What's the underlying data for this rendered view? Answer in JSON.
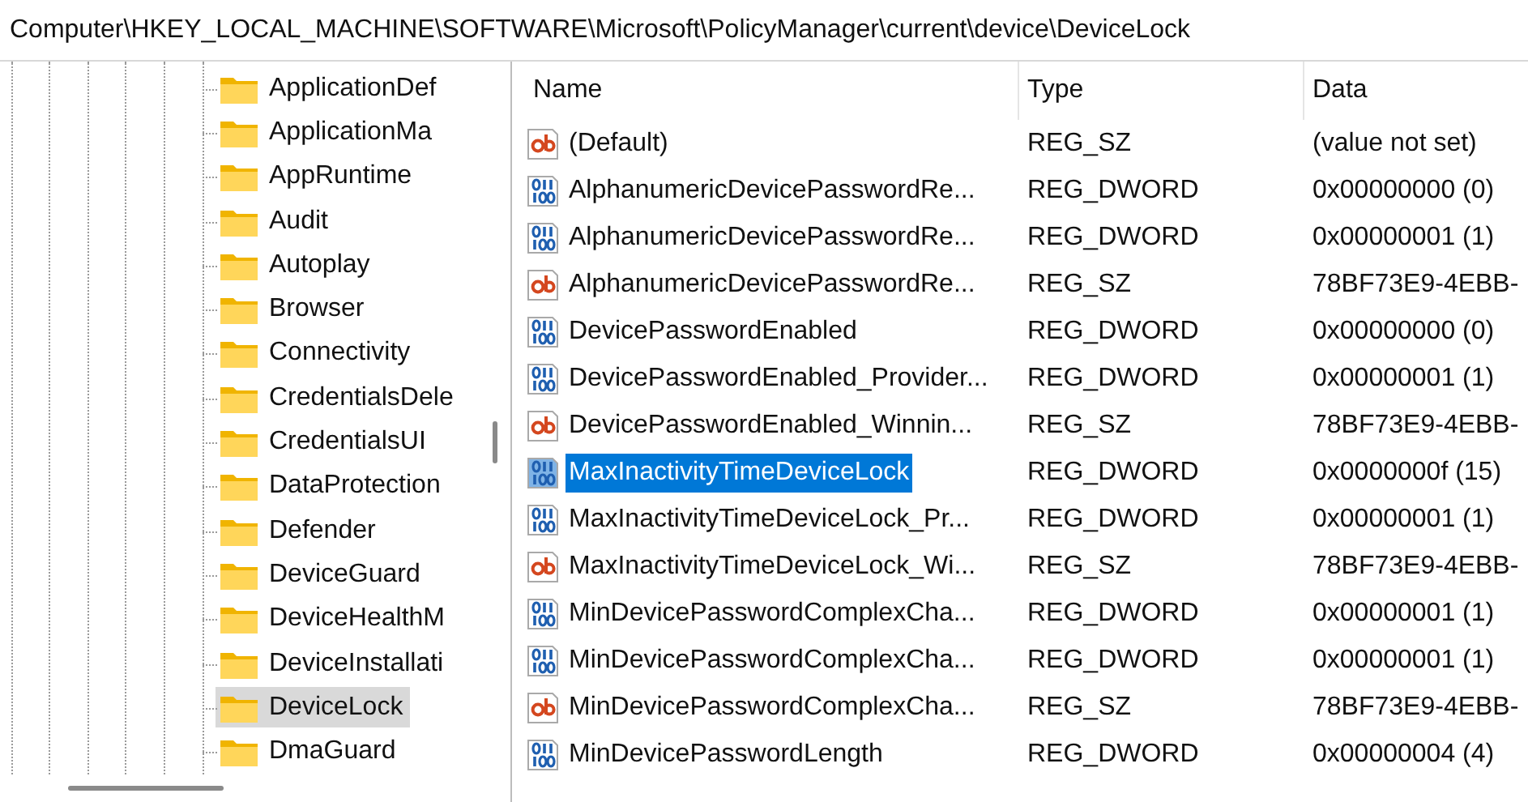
{
  "address_bar": {
    "path": "Computer\\HKEY_LOCAL_MACHINE\\SOFTWARE\\Microsoft\\PolicyManager\\current\\device\\DeviceLock"
  },
  "tree": {
    "items": [
      {
        "label": "ApplicationDef",
        "selected": false
      },
      {
        "label": "ApplicationMa",
        "selected": false
      },
      {
        "label": "AppRuntime",
        "selected": false
      },
      {
        "label": "Audit",
        "selected": false
      },
      {
        "label": "Autoplay",
        "selected": false
      },
      {
        "label": "Browser",
        "selected": false
      },
      {
        "label": "Connectivity",
        "selected": false
      },
      {
        "label": "CredentialsDele",
        "selected": false
      },
      {
        "label": "CredentialsUI",
        "selected": false
      },
      {
        "label": "DataProtection",
        "selected": false
      },
      {
        "label": "Defender",
        "selected": false
      },
      {
        "label": "DeviceGuard",
        "selected": false
      },
      {
        "label": "DeviceHealthM",
        "selected": false
      },
      {
        "label": "DeviceInstallati",
        "selected": false
      },
      {
        "label": "DeviceLock",
        "selected": true
      },
      {
        "label": "DmaGuard",
        "selected": false
      }
    ]
  },
  "table": {
    "columns": [
      "Name",
      "Type",
      "Data"
    ],
    "rows": [
      {
        "kind": "string",
        "name": "(Default)",
        "type": "REG_SZ",
        "data": "(value not set)",
        "selected": false
      },
      {
        "kind": "dword",
        "name": "AlphanumericDevicePasswordRe...",
        "type": "REG_DWORD",
        "data": "0x00000000 (0)",
        "selected": false
      },
      {
        "kind": "dword",
        "name": "AlphanumericDevicePasswordRe...",
        "type": "REG_DWORD",
        "data": "0x00000001 (1)",
        "selected": false
      },
      {
        "kind": "string",
        "name": "AlphanumericDevicePasswordRe...",
        "type": "REG_SZ",
        "data": "78BF73E9-4EBB-",
        "selected": false
      },
      {
        "kind": "dword",
        "name": "DevicePasswordEnabled",
        "type": "REG_DWORD",
        "data": "0x00000000 (0)",
        "selected": false
      },
      {
        "kind": "dword",
        "name": "DevicePasswordEnabled_Provider...",
        "type": "REG_DWORD",
        "data": "0x00000001 (1)",
        "selected": false
      },
      {
        "kind": "string",
        "name": "DevicePasswordEnabled_Winnin...",
        "type": "REG_SZ",
        "data": "78BF73E9-4EBB-",
        "selected": false
      },
      {
        "kind": "dword",
        "name": "MaxInactivityTimeDeviceLock",
        "type": "REG_DWORD",
        "data": "0x0000000f (15)",
        "selected": true
      },
      {
        "kind": "dword",
        "name": "MaxInactivityTimeDeviceLock_Pr...",
        "type": "REG_DWORD",
        "data": "0x00000001 (1)",
        "selected": false
      },
      {
        "kind": "string",
        "name": "MaxInactivityTimeDeviceLock_Wi...",
        "type": "REG_SZ",
        "data": "78BF73E9-4EBB-",
        "selected": false
      },
      {
        "kind": "dword",
        "name": "MinDevicePasswordComplexCha...",
        "type": "REG_DWORD",
        "data": "0x00000001 (1)",
        "selected": false
      },
      {
        "kind": "dword",
        "name": "MinDevicePasswordComplexCha...",
        "type": "REG_DWORD",
        "data": "0x00000001 (1)",
        "selected": false
      },
      {
        "kind": "string",
        "name": "MinDevicePasswordComplexCha...",
        "type": "REG_SZ",
        "data": "78BF73E9-4EBB-",
        "selected": false
      },
      {
        "kind": "dword",
        "name": "MinDevicePasswordLength",
        "type": "REG_DWORD",
        "data": "0x00000004 (4)",
        "selected": false
      }
    ]
  }
}
